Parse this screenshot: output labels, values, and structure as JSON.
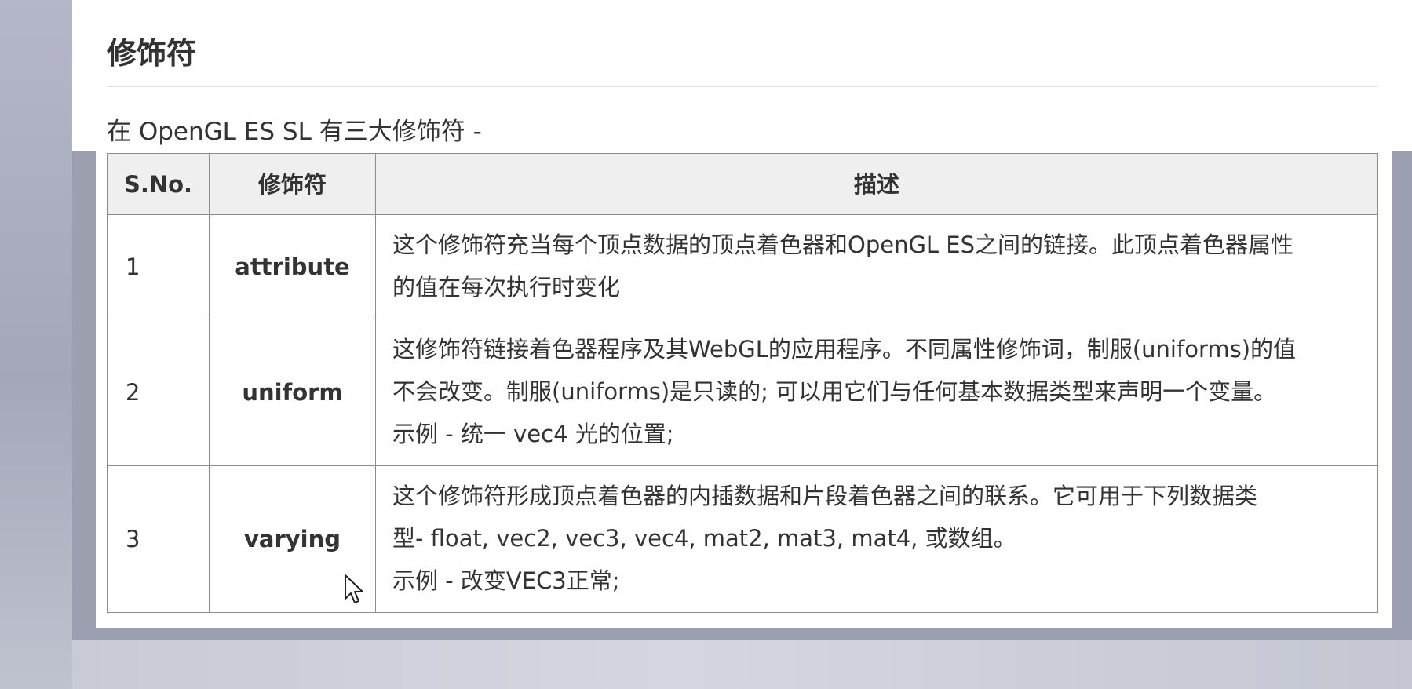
{
  "section": {
    "title": "修饰符",
    "intro": "在 OpenGL ES SL 有三大修饰符 -"
  },
  "table": {
    "headers": {
      "sno": "S.No.",
      "modifier": "修饰符",
      "description": "描述"
    },
    "rows": [
      {
        "sno": "1",
        "modifier": "attribute",
        "description": [
          "这个修饰符充当每个顶点数据的顶点着色器和OpenGL ES之间的链接。此顶点着色器属性",
          "的值在每次执行时变化"
        ]
      },
      {
        "sno": "2",
        "modifier": "uniform",
        "description": [
          "这修饰符链接着色器程序及其WebGL的应用程序。不同属性修饰词，制服(uniforms)的值",
          "不会改变。制服(uniforms)是只读的; 可以用它们与任何基本数据类型来声明一个变量。",
          "示例 - 统一 vec4 光的位置;"
        ]
      },
      {
        "sno": "3",
        "modifier": "varying",
        "description": [
          "这个修饰符形成顶点着色器的内插数据和片段着色器之间的联系。它可用于下列数据类",
          "型- float, vec2, vec3, vec4, mat2, mat3, mat4, 或数组。",
          "示例 - 改变VEC3正常;"
        ]
      }
    ]
  },
  "cursor": {
    "icon": "arrow-pointer"
  },
  "colors": {
    "text": "#333333",
    "header_bg": "#efefef",
    "border": "#8d8d8d",
    "backdrop": "#9c9fb0"
  }
}
